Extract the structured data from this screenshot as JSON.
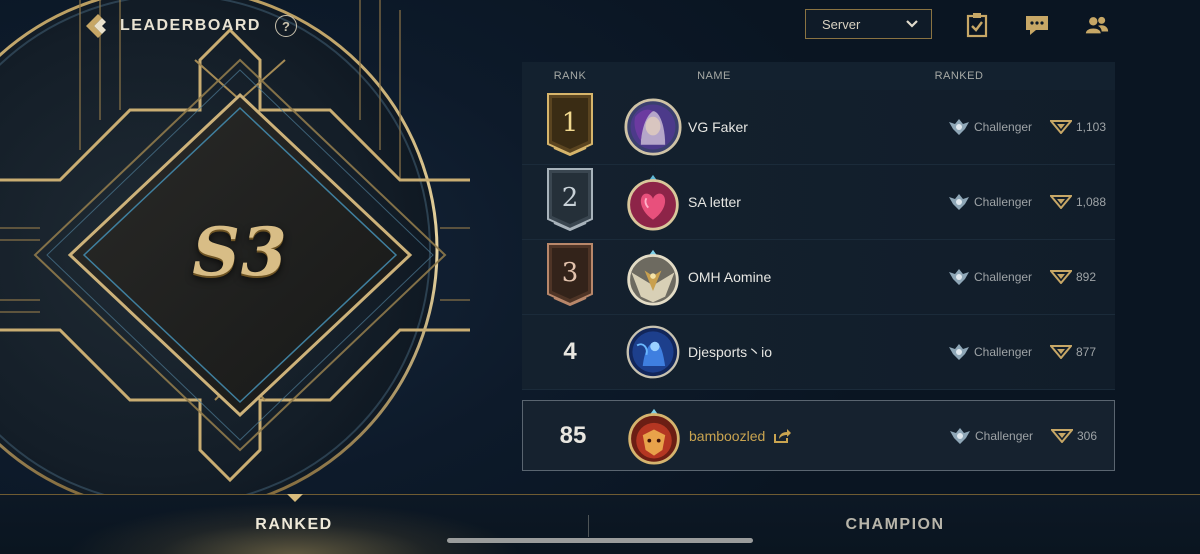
{
  "header": {
    "title": "LEADERBOARD",
    "help_glyph": "?",
    "back_icon": "back-chevron-icon"
  },
  "season": {
    "label": "S3"
  },
  "server_select": {
    "selected": "Server"
  },
  "top_icons": [
    "missions-icon",
    "chat-icon",
    "friends-icon"
  ],
  "table": {
    "columns": {
      "rank": "RANK",
      "name": "NAME",
      "ranked": "RANKED"
    },
    "rows": [
      {
        "rank": "1",
        "name": "VG Faker",
        "tier": "Challenger",
        "points": "1,103",
        "banner": "gold"
      },
      {
        "rank": "2",
        "name": "SA letter",
        "tier": "Challenger",
        "points": "1,088",
        "banner": "silver"
      },
      {
        "rank": "3",
        "name": "OMH Aomine",
        "tier": "Challenger",
        "points": "892",
        "banner": "bronze"
      },
      {
        "rank": "4",
        "name": "Djesports丶io",
        "tier": "Challenger",
        "points": "877",
        "banner": "none"
      }
    ],
    "self_row": {
      "rank": "85",
      "name": "bamboozled",
      "tier": "Challenger",
      "points": "306"
    }
  },
  "tabs": {
    "ranked": "RANKED",
    "champion": "CHAMPION",
    "active": "ranked"
  },
  "colors": {
    "gold": "#c9a450",
    "background": "#0b1726",
    "border_gold": "#8a7342"
  }
}
